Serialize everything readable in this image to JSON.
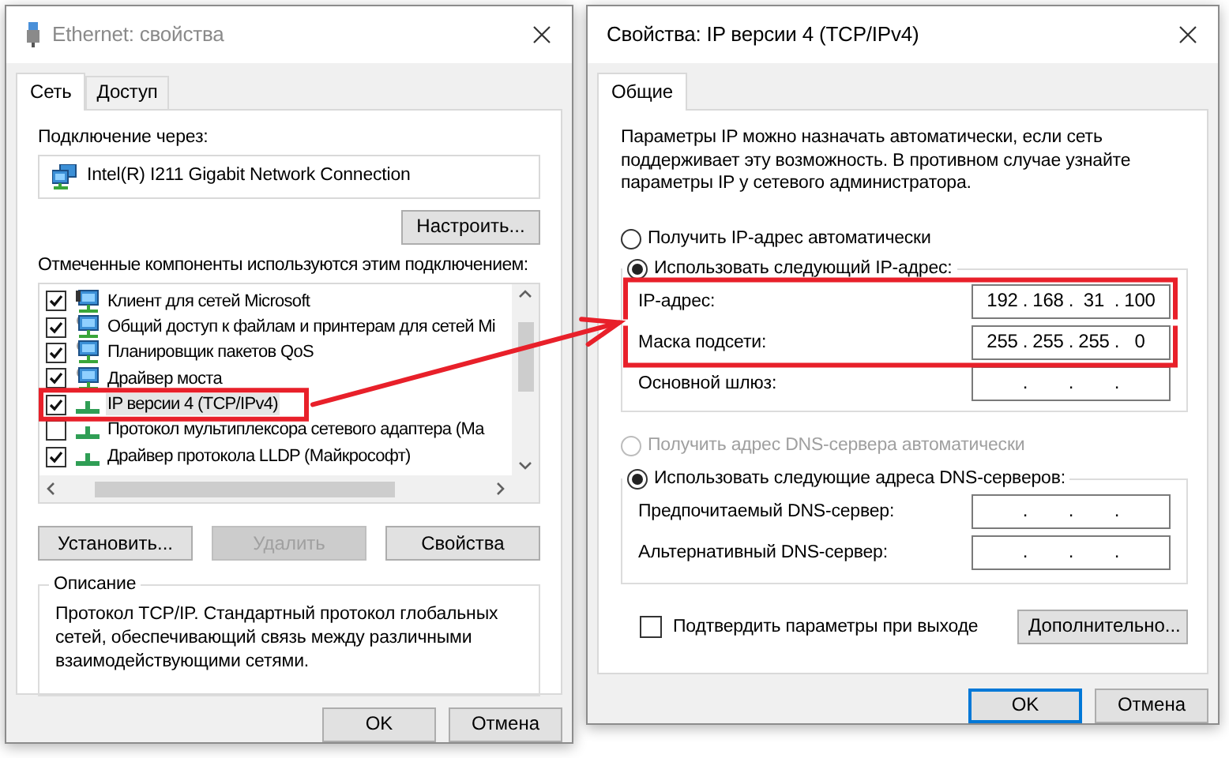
{
  "ethernet_window": {
    "title": "Ethernet: свойства",
    "tabs": [
      {
        "label": "Сеть",
        "selected": true
      },
      {
        "label": "Доступ",
        "selected": false
      }
    ],
    "connect_label": "Подключение через:",
    "adapter": "Intel(R) I211 Gigabit Network Connection",
    "configure_button": "Настроить...",
    "components_label": "Отмеченные компоненты используются этим подключением:",
    "components": [
      {
        "kind": "client",
        "label": "Клиент для сетей Microsoft",
        "checked": true,
        "selected": false,
        "highlighted": false
      },
      {
        "kind": "service",
        "label": "Общий доступ к файлам и принтерам для сетей Mi",
        "checked": true,
        "selected": false,
        "highlighted": false
      },
      {
        "kind": "service",
        "label": "Планировщик пакетов QoS",
        "checked": true,
        "selected": false,
        "highlighted": false
      },
      {
        "kind": "service",
        "label": "Драйвер моста",
        "checked": true,
        "selected": false,
        "highlighted": false
      },
      {
        "kind": "protocol",
        "label": "IP версии 4 (TCP/IPv4)",
        "checked": true,
        "selected": true,
        "highlighted": true
      },
      {
        "kind": "protocol",
        "label": "Протокол мультиплексора сетевого адаптера (Ма",
        "checked": false,
        "selected": false,
        "highlighted": false
      },
      {
        "kind": "protocol",
        "label": "Драйвер протокола LLDP (Майкрософт)",
        "checked": true,
        "selected": false,
        "highlighted": false
      }
    ],
    "buttons": [
      {
        "label": "Установить...",
        "disabled": false
      },
      {
        "label": "Удалить",
        "disabled": true
      },
      {
        "label": "Свойства",
        "disabled": false
      }
    ],
    "description": {
      "legend": "Описание",
      "text": "Протокол TCP/IP. Стандартный протокол глобальных сетей, обеспечивающий связь между различными взаимодействующими сетями."
    },
    "footer_buttons": [
      {
        "label": "OK",
        "focused": false
      },
      {
        "label": "Отмена",
        "focused": false
      }
    ]
  },
  "ipv4_window": {
    "title": "Свойства: IP версии 4 (TCP/IPv4)",
    "tabs": [
      {
        "label": "Общие",
        "selected": true
      }
    ],
    "intro": "Параметры IP можно назначать автоматически, если сеть поддерживает эту возможность. В противном случае узнайте параметры IP у сетевого администратора.",
    "ip_mode": [
      {
        "label": "Получить IP-адрес автоматически",
        "selected": false,
        "disabled": false
      },
      {
        "label": "Использовать следующий IP-адрес:",
        "selected": true,
        "disabled": false
      }
    ],
    "ip_fields": [
      {
        "label": "IP-адрес:",
        "octets": [
          "192",
          "168",
          "31",
          "100"
        ],
        "separators": [
          ".",
          ".",
          "."
        ],
        "highlighted": true
      },
      {
        "label": "Маска подсети:",
        "octets": [
          "255",
          "255",
          "255",
          "0"
        ],
        "separators": [
          ".",
          ".",
          "."
        ],
        "highlighted": true
      },
      {
        "label": "Основной шлюз:",
        "separators": [
          ".",
          ".",
          "."
        ],
        "highlighted": false
      }
    ],
    "dns_mode": [
      {
        "label": "Получить адрес DNS-сервера автоматически",
        "selected": false,
        "disabled": true
      },
      {
        "label": "Использовать следующие адреса DNS-серверов:",
        "selected": true,
        "disabled": false
      }
    ],
    "dns_fields": [
      {
        "label": "Предпочитаемый DNS-сервер:",
        "separators": [
          ".",
          ".",
          "."
        ]
      },
      {
        "label": "Альтернативный DNS-сервер:",
        "separators": [
          ".",
          ".",
          "."
        ]
      }
    ],
    "validate_checkbox": {
      "label": "Подтвердить параметры при выходе",
      "checked": false
    },
    "advanced_button": "Дополнительно...",
    "footer_buttons": [
      {
        "label": "OK",
        "focused": true
      },
      {
        "label": "Отмена",
        "focused": false
      }
    ]
  }
}
